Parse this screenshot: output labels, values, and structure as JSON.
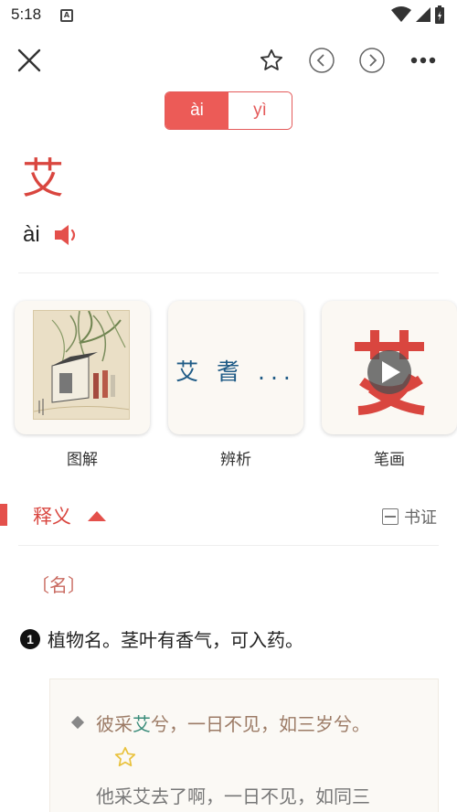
{
  "status_bar": {
    "time": "5:18",
    "notification_glyph": "A"
  },
  "toolbar": {
    "close_icon": "close-icon",
    "star_icon": "star-icon",
    "prev_icon": "chevron-left-circle-icon",
    "next_icon": "chevron-right-circle-icon",
    "more_icon": "more-icon"
  },
  "pronunciation_tabs": [
    {
      "label": "ài",
      "active": true
    },
    {
      "label": "yì",
      "active": false
    }
  ],
  "entry": {
    "character": "艾",
    "pinyin": "ài"
  },
  "cards": [
    {
      "label": "图解"
    },
    {
      "label": "辨析",
      "preview": "艾 耆 ..."
    },
    {
      "label": "笔画",
      "preview_char": "艾"
    }
  ],
  "section": {
    "title": "释义",
    "shuzheng_label": "书证"
  },
  "definition": {
    "pos": "〔名〕",
    "number": "1",
    "text": "植物名。茎叶有香气，可入药。",
    "quote_pre": "彼采",
    "quote_highlight": "艾",
    "quote_post": "兮，一日不见，如三岁兮。",
    "translation": "他采艾去了啊，一日不见，如同三"
  },
  "colors": {
    "accent": "#ec5b57",
    "teal": "#3a8c7a",
    "bianxi_blue": "#1f5b86"
  }
}
